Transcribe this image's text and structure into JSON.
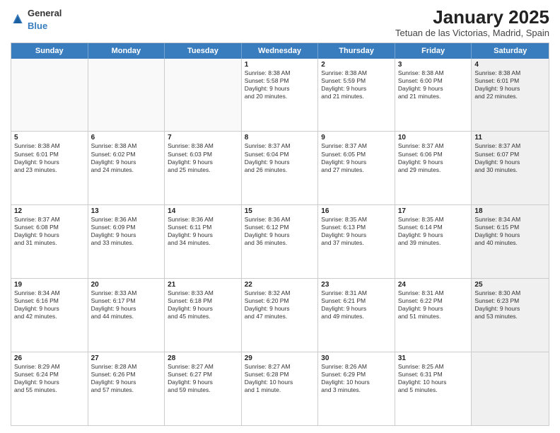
{
  "header": {
    "logo_general": "General",
    "logo_blue": "Blue",
    "month_title": "January 2025",
    "location": "Tetuan de las Victorias, Madrid, Spain"
  },
  "weekdays": [
    "Sunday",
    "Monday",
    "Tuesday",
    "Wednesday",
    "Thursday",
    "Friday",
    "Saturday"
  ],
  "rows": [
    {
      "cells": [
        {
          "day": "",
          "text": "",
          "empty": true
        },
        {
          "day": "",
          "text": "",
          "empty": true
        },
        {
          "day": "",
          "text": "",
          "empty": true
        },
        {
          "day": "1",
          "text": "Sunrise: 8:38 AM\nSunset: 5:58 PM\nDaylight: 9 hours\nand 20 minutes.",
          "empty": false
        },
        {
          "day": "2",
          "text": "Sunrise: 8:38 AM\nSunset: 5:59 PM\nDaylight: 9 hours\nand 21 minutes.",
          "empty": false
        },
        {
          "day": "3",
          "text": "Sunrise: 8:38 AM\nSunset: 6:00 PM\nDaylight: 9 hours\nand 21 minutes.",
          "empty": false
        },
        {
          "day": "4",
          "text": "Sunrise: 8:38 AM\nSunset: 6:01 PM\nDaylight: 9 hours\nand 22 minutes.",
          "empty": false,
          "shaded": true
        }
      ]
    },
    {
      "cells": [
        {
          "day": "5",
          "text": "Sunrise: 8:38 AM\nSunset: 6:01 PM\nDaylight: 9 hours\nand 23 minutes.",
          "empty": false
        },
        {
          "day": "6",
          "text": "Sunrise: 8:38 AM\nSunset: 6:02 PM\nDaylight: 9 hours\nand 24 minutes.",
          "empty": false
        },
        {
          "day": "7",
          "text": "Sunrise: 8:38 AM\nSunset: 6:03 PM\nDaylight: 9 hours\nand 25 minutes.",
          "empty": false
        },
        {
          "day": "8",
          "text": "Sunrise: 8:37 AM\nSunset: 6:04 PM\nDaylight: 9 hours\nand 26 minutes.",
          "empty": false
        },
        {
          "day": "9",
          "text": "Sunrise: 8:37 AM\nSunset: 6:05 PM\nDaylight: 9 hours\nand 27 minutes.",
          "empty": false
        },
        {
          "day": "10",
          "text": "Sunrise: 8:37 AM\nSunset: 6:06 PM\nDaylight: 9 hours\nand 29 minutes.",
          "empty": false
        },
        {
          "day": "11",
          "text": "Sunrise: 8:37 AM\nSunset: 6:07 PM\nDaylight: 9 hours\nand 30 minutes.",
          "empty": false,
          "shaded": true
        }
      ]
    },
    {
      "cells": [
        {
          "day": "12",
          "text": "Sunrise: 8:37 AM\nSunset: 6:08 PM\nDaylight: 9 hours\nand 31 minutes.",
          "empty": false
        },
        {
          "day": "13",
          "text": "Sunrise: 8:36 AM\nSunset: 6:09 PM\nDaylight: 9 hours\nand 33 minutes.",
          "empty": false
        },
        {
          "day": "14",
          "text": "Sunrise: 8:36 AM\nSunset: 6:11 PM\nDaylight: 9 hours\nand 34 minutes.",
          "empty": false
        },
        {
          "day": "15",
          "text": "Sunrise: 8:36 AM\nSunset: 6:12 PM\nDaylight: 9 hours\nand 36 minutes.",
          "empty": false
        },
        {
          "day": "16",
          "text": "Sunrise: 8:35 AM\nSunset: 6:13 PM\nDaylight: 9 hours\nand 37 minutes.",
          "empty": false
        },
        {
          "day": "17",
          "text": "Sunrise: 8:35 AM\nSunset: 6:14 PM\nDaylight: 9 hours\nand 39 minutes.",
          "empty": false
        },
        {
          "day": "18",
          "text": "Sunrise: 8:34 AM\nSunset: 6:15 PM\nDaylight: 9 hours\nand 40 minutes.",
          "empty": false,
          "shaded": true
        }
      ]
    },
    {
      "cells": [
        {
          "day": "19",
          "text": "Sunrise: 8:34 AM\nSunset: 6:16 PM\nDaylight: 9 hours\nand 42 minutes.",
          "empty": false
        },
        {
          "day": "20",
          "text": "Sunrise: 8:33 AM\nSunset: 6:17 PM\nDaylight: 9 hours\nand 44 minutes.",
          "empty": false
        },
        {
          "day": "21",
          "text": "Sunrise: 8:33 AM\nSunset: 6:18 PM\nDaylight: 9 hours\nand 45 minutes.",
          "empty": false
        },
        {
          "day": "22",
          "text": "Sunrise: 8:32 AM\nSunset: 6:20 PM\nDaylight: 9 hours\nand 47 minutes.",
          "empty": false
        },
        {
          "day": "23",
          "text": "Sunrise: 8:31 AM\nSunset: 6:21 PM\nDaylight: 9 hours\nand 49 minutes.",
          "empty": false
        },
        {
          "day": "24",
          "text": "Sunrise: 8:31 AM\nSunset: 6:22 PM\nDaylight: 9 hours\nand 51 minutes.",
          "empty": false
        },
        {
          "day": "25",
          "text": "Sunrise: 8:30 AM\nSunset: 6:23 PM\nDaylight: 9 hours\nand 53 minutes.",
          "empty": false,
          "shaded": true
        }
      ]
    },
    {
      "cells": [
        {
          "day": "26",
          "text": "Sunrise: 8:29 AM\nSunset: 6:24 PM\nDaylight: 9 hours\nand 55 minutes.",
          "empty": false
        },
        {
          "day": "27",
          "text": "Sunrise: 8:28 AM\nSunset: 6:26 PM\nDaylight: 9 hours\nand 57 minutes.",
          "empty": false
        },
        {
          "day": "28",
          "text": "Sunrise: 8:27 AM\nSunset: 6:27 PM\nDaylight: 9 hours\nand 59 minutes.",
          "empty": false
        },
        {
          "day": "29",
          "text": "Sunrise: 8:27 AM\nSunset: 6:28 PM\nDaylight: 10 hours\nand 1 minute.",
          "empty": false
        },
        {
          "day": "30",
          "text": "Sunrise: 8:26 AM\nSunset: 6:29 PM\nDaylight: 10 hours\nand 3 minutes.",
          "empty": false
        },
        {
          "day": "31",
          "text": "Sunrise: 8:25 AM\nSunset: 6:31 PM\nDaylight: 10 hours\nand 5 minutes.",
          "empty": false
        },
        {
          "day": "",
          "text": "",
          "empty": true,
          "shaded": true
        }
      ]
    }
  ]
}
